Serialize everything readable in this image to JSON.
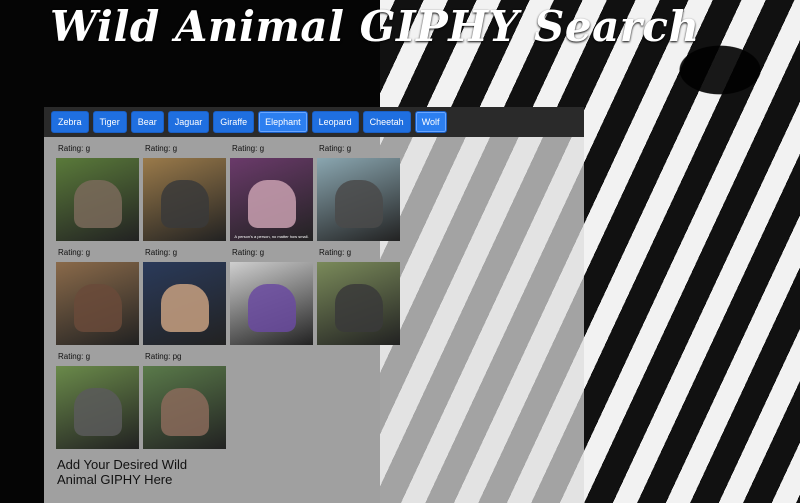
{
  "title": "Wild Animal GIPHY Search",
  "buttons": [
    {
      "label": "Zebra",
      "active": false
    },
    {
      "label": "Tiger",
      "active": false
    },
    {
      "label": "Bear",
      "active": false
    },
    {
      "label": "Jaguar",
      "active": false
    },
    {
      "label": "Giraffe",
      "active": false
    },
    {
      "label": "Elephant",
      "active": true
    },
    {
      "label": "Leopard",
      "active": false
    },
    {
      "label": "Cheetah",
      "active": false
    },
    {
      "label": "Wolf",
      "active": true
    }
  ],
  "gifs": [
    {
      "rating": "Rating: g",
      "bg": "#5a7a3a",
      "fg": "#7a6a5a"
    },
    {
      "rating": "Rating: g",
      "bg": "#9a7a4a",
      "fg": "#3a3a3a"
    },
    {
      "rating": "Rating: g",
      "bg": "#6a3a6a",
      "fg": "#c9a0b0",
      "caption": "A person's a person, no matter how small."
    },
    {
      "rating": "Rating: g",
      "bg": "#8aa6b0",
      "fg": "#4a4a4a"
    },
    {
      "rating": "Rating: g",
      "bg": "#8a6a4a",
      "fg": "#6a4a3a"
    },
    {
      "rating": "Rating: g",
      "bg": "#2a3a5a",
      "fg": "#c8a080"
    },
    {
      "rating": "Rating: g",
      "bg": "#cfcfcf",
      "fg": "#6a4aa0"
    },
    {
      "rating": "Rating: g",
      "bg": "#7a8a5a",
      "fg": "#3a3a3a"
    },
    {
      "rating": "Rating: g",
      "bg": "#6a8a4a",
      "fg": "#5a5a5a"
    },
    {
      "rating": "Rating: pg",
      "bg": "#5a7a4a",
      "fg": "#8a6a5a"
    }
  ],
  "footer": "Add Your Desired Wild Animal GIPHY Here"
}
